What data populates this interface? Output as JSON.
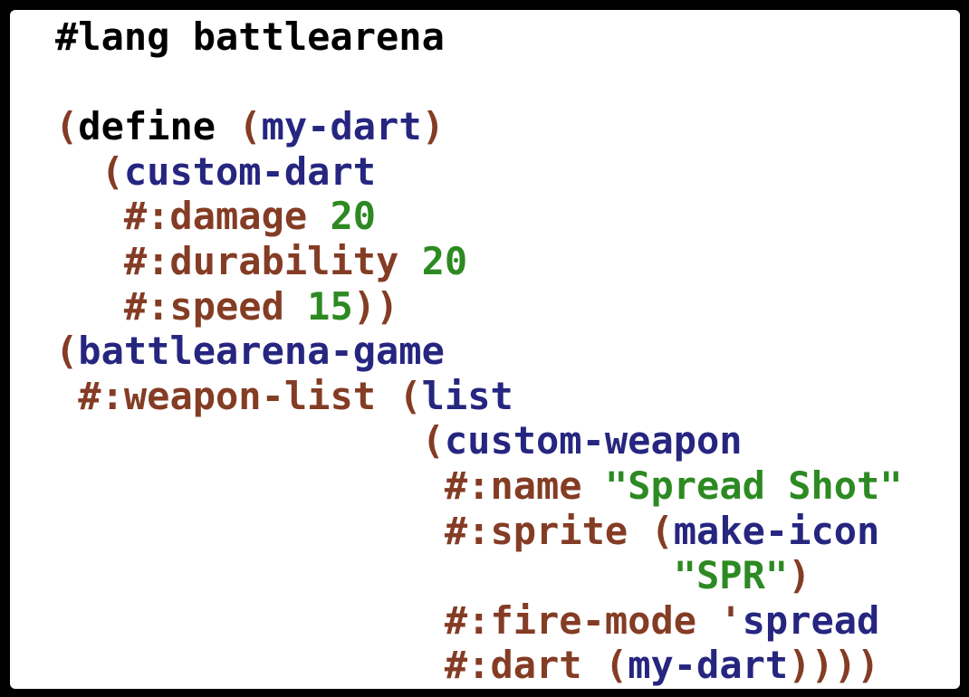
{
  "editor": {
    "lines": [
      [
        {
          "t": "#lang battlearena",
          "k": "plain"
        }
      ],
      [],
      [
        {
          "t": "(",
          "k": "paren"
        },
        {
          "t": "define",
          "k": "plain"
        },
        {
          "t": " ",
          "k": "plain"
        },
        {
          "t": "(",
          "k": "paren"
        },
        {
          "t": "my-dart",
          "k": "id"
        },
        {
          "t": ")",
          "k": "paren"
        }
      ],
      [
        {
          "t": "  ",
          "k": "plain"
        },
        {
          "t": "(",
          "k": "paren"
        },
        {
          "t": "custom-dart",
          "k": "id"
        }
      ],
      [
        {
          "t": "   ",
          "k": "plain"
        },
        {
          "t": "#:damage",
          "k": "kw"
        },
        {
          "t": " ",
          "k": "plain"
        },
        {
          "t": "20",
          "k": "num"
        }
      ],
      [
        {
          "t": "   ",
          "k": "plain"
        },
        {
          "t": "#:durability",
          "k": "kw"
        },
        {
          "t": " ",
          "k": "plain"
        },
        {
          "t": "20",
          "k": "num"
        }
      ],
      [
        {
          "t": "   ",
          "k": "plain"
        },
        {
          "t": "#:speed",
          "k": "kw"
        },
        {
          "t": " ",
          "k": "plain"
        },
        {
          "t": "15",
          "k": "num"
        },
        {
          "t": "))",
          "k": "paren"
        }
      ],
      [
        {
          "t": "(",
          "k": "paren"
        },
        {
          "t": "battlearena-game",
          "k": "id"
        }
      ],
      [
        {
          "t": " ",
          "k": "plain"
        },
        {
          "t": "#:weapon-list",
          "k": "kw"
        },
        {
          "t": " ",
          "k": "plain"
        },
        {
          "t": "(",
          "k": "paren"
        },
        {
          "t": "list",
          "k": "id"
        }
      ],
      [
        {
          "t": "                ",
          "k": "plain"
        },
        {
          "t": "(",
          "k": "paren"
        },
        {
          "t": "custom-weapon",
          "k": "id"
        }
      ],
      [
        {
          "t": "                 ",
          "k": "plain"
        },
        {
          "t": "#:name",
          "k": "kw"
        },
        {
          "t": " ",
          "k": "plain"
        },
        {
          "t": "\"Spread Shot\"",
          "k": "str"
        }
      ],
      [
        {
          "t": "                 ",
          "k": "plain"
        },
        {
          "t": "#:sprite",
          "k": "kw"
        },
        {
          "t": " ",
          "k": "plain"
        },
        {
          "t": "(",
          "k": "paren"
        },
        {
          "t": "make-icon",
          "k": "id"
        }
      ],
      [
        {
          "t": "                           ",
          "k": "plain"
        },
        {
          "t": "\"SPR\"",
          "k": "str"
        },
        {
          "t": ")",
          "k": "paren"
        }
      ],
      [
        {
          "t": "                 ",
          "k": "plain"
        },
        {
          "t": "#:fire-mode",
          "k": "kw"
        },
        {
          "t": " ",
          "k": "plain"
        },
        {
          "t": "'",
          "k": "sym"
        },
        {
          "t": "spread",
          "k": "id"
        }
      ],
      [
        {
          "t": "                 ",
          "k": "plain"
        },
        {
          "t": "#:dart",
          "k": "kw"
        },
        {
          "t": " ",
          "k": "plain"
        },
        {
          "t": "(",
          "k": "paren"
        },
        {
          "t": "my-dart",
          "k": "id"
        },
        {
          "t": "))))",
          "k": "paren"
        }
      ]
    ]
  },
  "colors": {
    "background": "#ffffff",
    "frame": "#000000",
    "plain": "#000000",
    "paren": "#843c24",
    "identifier": "#262680",
    "keyword": "#843c24",
    "number": "#2d8a22",
    "string": "#2d8a22"
  }
}
